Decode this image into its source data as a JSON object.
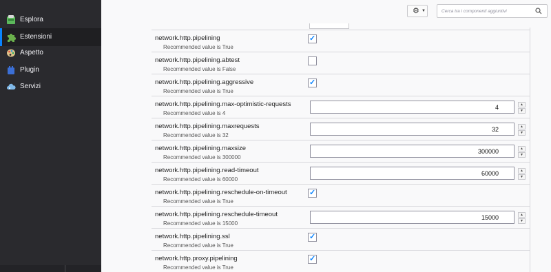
{
  "sidebar": {
    "items": [
      {
        "label": "Esplora",
        "icon": "compass-icon"
      },
      {
        "label": "Estensioni",
        "icon": "puzzle-icon",
        "selected": true
      },
      {
        "label": "Aspetto",
        "icon": "palette-icon"
      },
      {
        "label": "Plugin",
        "icon": "plugin-icon"
      },
      {
        "label": "Servizi",
        "icon": "cloud-icon"
      }
    ]
  },
  "toolbar": {
    "search_placeholder": "Cerca tra i componenti aggiuntivi",
    "gear_icon": "gear-icon"
  },
  "prefs": [
    {
      "name": "network.http.pipelining",
      "rec": "Recommended value is True",
      "type": "checkbox",
      "checked": true
    },
    {
      "name": "network.http.pipelining.abtest",
      "rec": "Recommended value is False",
      "type": "checkbox",
      "checked": false
    },
    {
      "name": "network.http.pipelining.aggressive",
      "rec": "Recommended value is True",
      "type": "checkbox",
      "checked": true
    },
    {
      "name": "network.http.pipelining.max-optimistic-requests",
      "rec": "Recommended value is 4",
      "type": "number",
      "value": "4"
    },
    {
      "name": "network.http.pipelining.maxrequests",
      "rec": "Recommended value is 32",
      "type": "number",
      "value": "32"
    },
    {
      "name": "network.http.pipelining.maxsize",
      "rec": "Recommended value is 300000",
      "type": "number",
      "value": "300000"
    },
    {
      "name": "network.http.pipelining.read-timeout",
      "rec": "Recommended value is 60000",
      "type": "number",
      "value": "60000"
    },
    {
      "name": "network.http.pipelining.reschedule-on-timeout",
      "rec": "Recommended value is True",
      "type": "checkbox",
      "checked": true
    },
    {
      "name": "network.http.pipelining.reschedule-timeout",
      "rec": "Recommended value is 15000",
      "type": "number",
      "value": "15000"
    },
    {
      "name": "network.http.pipelining.ssl",
      "rec": "Recommended value is True",
      "type": "checkbox",
      "checked": true
    },
    {
      "name": "network.http.proxy.pipelining",
      "rec": "Recommended value is True",
      "type": "checkbox",
      "checked": true
    }
  ],
  "colors": {
    "sidebar_bg": "#2a2a2e",
    "accent": "#0a84ff",
    "main_bg": "#f9f9fa"
  }
}
